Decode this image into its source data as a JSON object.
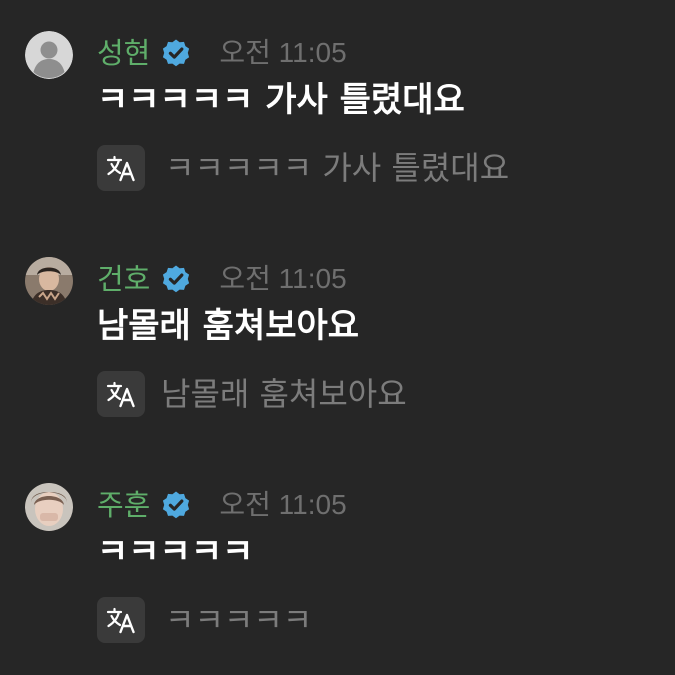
{
  "colors": {
    "background": "#262626",
    "username": "#5fae6a",
    "timestamp": "#6f6f6f",
    "message": "#ffffff",
    "translation": "#7c7c7c",
    "verified_badge": "#4fa9df"
  },
  "messages": [
    {
      "username": "성현",
      "verified": true,
      "time": "오전 11:05",
      "text": "ㅋㅋㅋㅋㅋ 가사 틀렸대요",
      "translation": "ㅋㅋㅋㅋㅋ 가사 틀렸대요",
      "avatar_icon": "default-avatar-icon"
    },
    {
      "username": "건호",
      "verified": true,
      "time": "오전 11:05",
      "text": "남몰래 훔쳐보아요",
      "translation": "남몰래 훔쳐보아요",
      "avatar_icon": "profile-photo"
    },
    {
      "username": "주훈",
      "verified": true,
      "time": "오전 11:05",
      "text": "ㅋㅋㅋㅋㅋ",
      "translation": "ㅋㅋㅋㅋㅋ",
      "avatar_icon": "profile-photo"
    }
  ],
  "icons": {
    "verified": "verified-badge-icon",
    "translate": "translate-icon"
  }
}
